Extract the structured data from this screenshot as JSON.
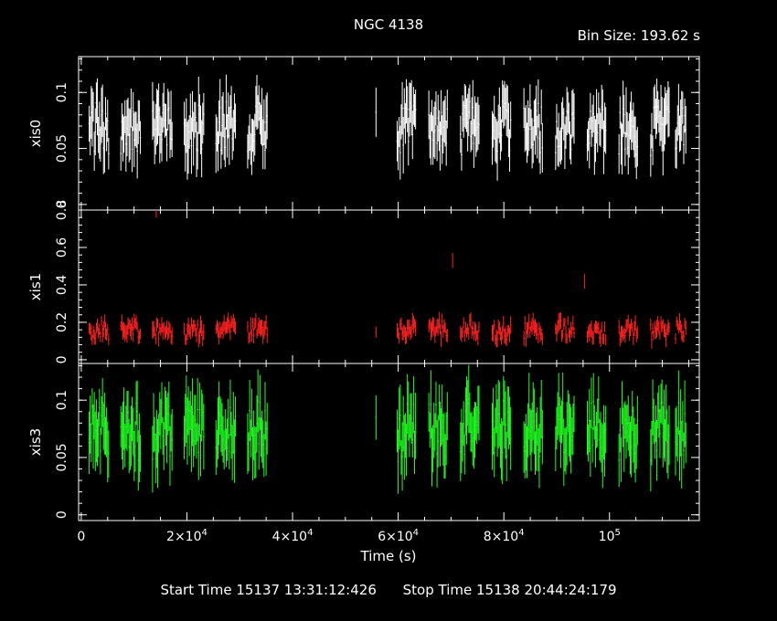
{
  "title": "NGC 4138",
  "bin_size_label": "Bin Size: 193.62 s",
  "xlabel": "Time (s)",
  "start_time_label": "Start Time 15137 13:31:12:426",
  "stop_time_label": "Stop Time 15138 20:44:24:179",
  "colors": {
    "background": "#000000",
    "axes": "#ffffff",
    "xis0": "#ffffff",
    "xis1": "#ff2020",
    "xis3": "#20ff20"
  },
  "chart_data": [
    {
      "type": "line",
      "panel": "top",
      "ylabel": "xis0",
      "xlim": [
        -500,
        117000
      ],
      "ylim": [
        -0.005,
        0.132
      ],
      "yticks": [
        {
          "v": 0,
          "t": "0"
        },
        {
          "v": 0.05,
          "t": "0.05"
        },
        {
          "v": 0.1,
          "t": "0.1"
        }
      ],
      "series": [
        {
          "color": "#ffffff",
          "segments": [
            [
              1500,
              5200
            ],
            [
              7500,
              11200
            ],
            [
              13500,
              17200
            ],
            [
              19500,
              23200
            ],
            [
              25500,
              29200
            ],
            [
              31500,
              35200
            ],
            [
              55800,
              55900
            ],
            [
              59800,
              63300
            ],
            [
              65800,
              69300
            ],
            [
              71800,
              75300
            ],
            [
              77800,
              81300
            ],
            [
              83800,
              87300
            ],
            [
              89800,
              93300
            ],
            [
              95800,
              99300
            ],
            [
              101800,
              105300
            ],
            [
              107800,
              111300
            ],
            [
              112500,
              114500
            ]
          ],
          "mean": 0.065,
          "spread": 0.022,
          "error": 0.022
        }
      ]
    },
    {
      "type": "line",
      "panel": "middle",
      "ylabel": "xis1",
      "xlim": [
        -500,
        117000
      ],
      "ylim": [
        -0.02,
        0.8
      ],
      "yticks": [
        {
          "v": 0,
          "t": "0"
        },
        {
          "v": 0.2,
          "t": "0.2"
        },
        {
          "v": 0.4,
          "t": "0.4"
        },
        {
          "v": 0.6,
          "t": "0.6"
        },
        {
          "v": 0.8,
          "t": "0.8"
        }
      ],
      "series": [
        {
          "color": "#ff2020",
          "segments": [
            [
              1500,
              5200
            ],
            [
              7500,
              11200
            ],
            [
              13500,
              17200
            ],
            [
              19500,
              23200
            ],
            [
              25500,
              29200
            ],
            [
              31500,
              35200
            ],
            [
              55800,
              55900
            ],
            [
              59800,
              63300
            ],
            [
              65800,
              69300
            ],
            [
              71800,
              75300
            ],
            [
              77800,
              81300
            ],
            [
              83800,
              87300
            ],
            [
              89800,
              93300
            ],
            [
              95800,
              99300
            ],
            [
              101800,
              105300
            ],
            [
              107800,
              111300
            ],
            [
              112500,
              114500
            ]
          ],
          "mean": 0.15,
          "spread": 0.05,
          "error": 0.04,
          "outliers": [
            {
              "x": 14200,
              "y": 0.8
            },
            {
              "x": 70300,
              "y": 0.53
            },
            {
              "x": 95300,
              "y": 0.42
            }
          ]
        }
      ]
    },
    {
      "type": "line",
      "panel": "bottom",
      "ylabel": "xis3",
      "xlim": [
        -500,
        117000
      ],
      "ylim": [
        -0.005,
        0.132
      ],
      "yticks": [
        {
          "v": 0,
          "t": "0"
        },
        {
          "v": 0.05,
          "t": "0.05"
        },
        {
          "v": 0.1,
          "t": "0.1"
        }
      ],
      "xticks": [
        {
          "v": 0,
          "t": "0",
          "pow": false
        },
        {
          "v": 20000,
          "t": "2×10",
          "pow": "4"
        },
        {
          "v": 40000,
          "t": "4×10",
          "pow": "4"
        },
        {
          "v": 60000,
          "t": "6×10",
          "pow": "4"
        },
        {
          "v": 80000,
          "t": "8×10",
          "pow": "4"
        },
        {
          "v": 100000,
          "t": "10",
          "pow": "5"
        }
      ],
      "series": [
        {
          "color": "#20ff20",
          "segments": [
            [
              1500,
              5200
            ],
            [
              7500,
              11200
            ],
            [
              13500,
              17200
            ],
            [
              19500,
              23200
            ],
            [
              25500,
              29200
            ],
            [
              31500,
              35200
            ],
            [
              55800,
              55900
            ],
            [
              59800,
              63300
            ],
            [
              65800,
              69300
            ],
            [
              71800,
              75300
            ],
            [
              77800,
              81300
            ],
            [
              83800,
              87300
            ],
            [
              89800,
              93300
            ],
            [
              95800,
              99300
            ],
            [
              101800,
              105300
            ],
            [
              107800,
              111300
            ],
            [
              112500,
              114500
            ]
          ],
          "mean": 0.07,
          "spread": 0.025,
          "error": 0.025
        }
      ]
    }
  ]
}
